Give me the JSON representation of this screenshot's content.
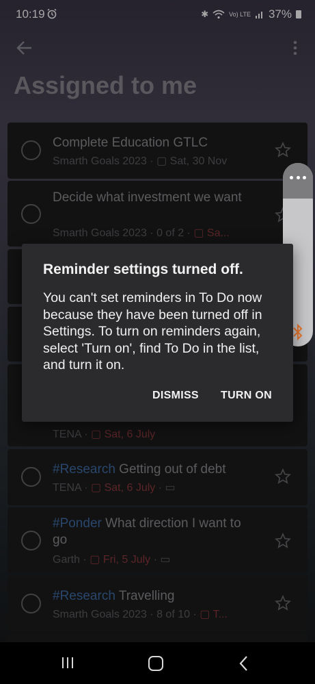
{
  "status_bar": {
    "time": "10:19",
    "signal_text": "Vo) LTE",
    "battery": "37%"
  },
  "header": {
    "title": "Assigned to me"
  },
  "tasks": [
    {
      "title": "Complete Education GTLC",
      "meta_list": "Smarth Goals 2023",
      "meta_date": "Sat, 30 Nov"
    },
    {
      "title": "Decide what investment we want",
      "meta_list": "Smarth Goals 2023",
      "meta_progress": "0 of 2",
      "meta_date": "Sa..."
    },
    {
      "meta_list": "TENA",
      "meta_date": "Sat, 6 July"
    },
    {
      "tag": "#Research",
      "title": " Getting out of debt",
      "meta_list": "TENA",
      "meta_date": "Sat, 6 July"
    },
    {
      "tag": "#Ponder",
      "title": " What direction I want to go",
      "meta_list": "Garth",
      "meta_date": "Fri, 5 July"
    },
    {
      "tag": "#Research",
      "title": " Travelling",
      "meta_list": "Smarth Goals 2023",
      "meta_progress": "8 of 10",
      "meta_date": "T..."
    }
  ],
  "dialog": {
    "title": "Reminder settings turned off.",
    "body": "You can't set reminders in To Do now because they have been turned off in Settings. To turn on reminders again, select 'Turn on', find To Do in the list, and turn it on.",
    "dismiss_label": "DISMISS",
    "turn_on_label": "TURN ON"
  },
  "colors": {
    "accent_tag": "#3f6ea6",
    "due_red": "#8c3a3e",
    "edge_icon": "#e8782f"
  }
}
